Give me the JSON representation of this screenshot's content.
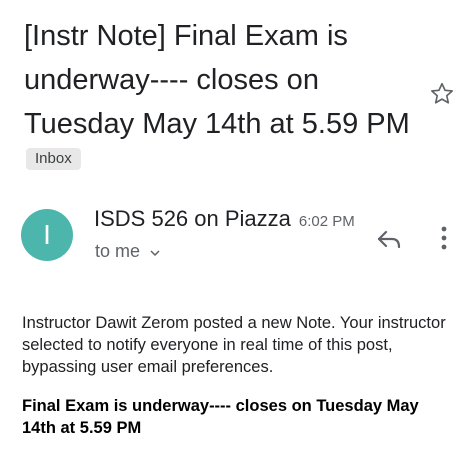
{
  "email": {
    "subject": "[Instr Note] Final Exam is underway---- closes on Tuesday May 14th at 5.59 PM",
    "label": "Inbox",
    "star_icon": "star-outline-icon",
    "sender": {
      "name": "ISDS 526 on Piazza",
      "time": "6:02 PM",
      "recipient": "to me",
      "avatar_letter": "I",
      "avatar_color": "#4db6ac"
    },
    "actions": {
      "reply_icon": "reply-icon",
      "more_icon": "more-vertical-icon"
    },
    "body": {
      "intro": "Instructor Dawit Zerom posted a new Note. Your instructor selected to notify everyone in real time of this post, bypassing user email preferences.",
      "headline": "Final Exam is underway---- closes on Tuesday May 14th at 5.59 PM"
    }
  },
  "colors": {
    "text_primary": "#202124",
    "text_secondary": "#5f6368",
    "chip_bg": "#e8e8e8",
    "icon": "#5f6368"
  }
}
